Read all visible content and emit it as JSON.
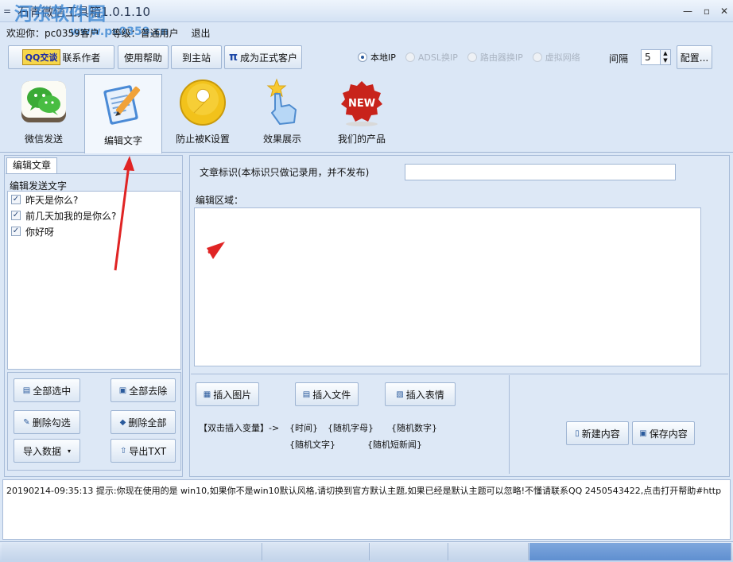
{
  "window": {
    "title": "石青微信工具箱1.0.1.10",
    "watermark_site": "河东软件园",
    "watermark_url": "www.pc0359.cn"
  },
  "user": {
    "welcome": "欢迎你：pc0359客户",
    "level": "等级：普通用户",
    "logout": "退出"
  },
  "toolbar": {
    "qq_badge": "QQ交谈",
    "contact": "联系作者",
    "help": "使用帮助",
    "site": "到主站",
    "pi": "π",
    "upgrade": "成为正式客户",
    "ip_options": [
      "本地IP",
      "ADSL换IP",
      "路由器换IP",
      "虚拟网络"
    ],
    "interval_label": "间隔",
    "interval_value": "5",
    "config": "配置..."
  },
  "tabs": [
    {
      "label": "微信发送",
      "icon": "wechat-icon"
    },
    {
      "label": "编辑文字",
      "icon": "edit-document-icon"
    },
    {
      "label": "防止被K设置",
      "icon": "wrench-icon"
    },
    {
      "label": "效果展示",
      "icon": "touch-hand-icon"
    },
    {
      "label": "我们的产品",
      "icon": "new-badge-icon"
    }
  ],
  "new_badge": "NEW",
  "left": {
    "tab": "编辑文章",
    "group": "编辑发送文字",
    "items": [
      "昨天是你么?",
      "前几天加我的是你么?",
      "你好呀"
    ],
    "buttons": {
      "select_all": "全部选中",
      "remove_all": "全部去除",
      "delete_checked": "删除勾选",
      "delete_all": "删除全部",
      "import": "导入数据",
      "export": "导出TXT"
    }
  },
  "right": {
    "doc_label": "文章标识(本标识只做记录用，并不发布)",
    "doc_value": "",
    "edit_label": "编辑区域：",
    "insert_image": "插入图片",
    "insert_file": "插入文件",
    "insert_emoji": "插入表情",
    "var_prompt": "【双击插入变量】->",
    "vars": [
      "{时间}",
      "{随机字母}",
      "{随机数字}",
      "{随机文字}",
      "{随机短新闻}"
    ],
    "new_content": "新建内容",
    "save_content": "保存内容"
  },
  "log": "20190214-09:35:13  提示:你现在使用的是 win10,如果你不是win10默认风格,请切换到官方默认主题,如果已经是默认主题可以忽略!不懂请联系QQ 2450543422,点击打开帮助#http"
}
